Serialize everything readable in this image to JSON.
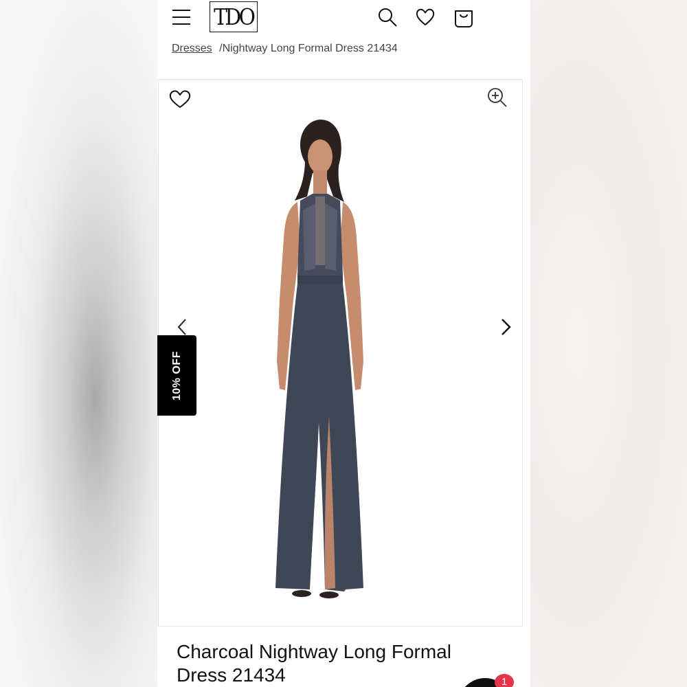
{
  "header": {
    "logo_text": "TDO",
    "icons": [
      "menu-icon",
      "search-icon",
      "heart-icon",
      "bag-icon"
    ]
  },
  "breadcrumb": {
    "parent": "Dresses",
    "separator": "/",
    "current": "Nightway Long Formal Dress 21434"
  },
  "gallery": {
    "icons": [
      "heart-icon",
      "zoom-in-icon",
      "chevron-left-icon",
      "chevron-right-icon"
    ],
    "dress_color": "#3f4656"
  },
  "promo": {
    "label": "10% OFF"
  },
  "product": {
    "title": "Charcoal Nightway Long Formal Dress 21434"
  },
  "chat": {
    "badge_count": "1",
    "badge_color": "#e8334d"
  }
}
